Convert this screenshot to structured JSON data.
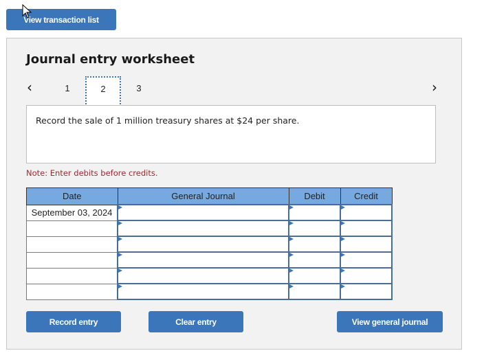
{
  "top_button": {
    "label": "View transaction list"
  },
  "worksheet": {
    "title": "Journal entry worksheet",
    "nav": {
      "prev_icon": "chevron-left-icon",
      "next_icon": "chevron-right-icon"
    },
    "pages": [
      "1",
      "2",
      "3"
    ],
    "active_page": "2",
    "description": "Record the sale of 1 million treasury shares at $24 per share.",
    "note": "Note: Enter debits before credits.",
    "table": {
      "headers": [
        "Date",
        "General Journal",
        "Debit",
        "Credit"
      ],
      "rows": [
        {
          "date": "September 03, 2024",
          "general_journal": "",
          "debit": "",
          "credit": ""
        },
        {
          "date": "",
          "general_journal": "",
          "debit": "",
          "credit": ""
        },
        {
          "date": "",
          "general_journal": "",
          "debit": "",
          "credit": ""
        },
        {
          "date": "",
          "general_journal": "",
          "debit": "",
          "credit": ""
        },
        {
          "date": "",
          "general_journal": "",
          "debit": "",
          "credit": ""
        },
        {
          "date": "",
          "general_journal": "",
          "debit": "",
          "credit": ""
        }
      ]
    },
    "buttons": {
      "record": "Record entry",
      "clear": "Clear entry",
      "view_journal": "View general journal"
    }
  },
  "colors": {
    "button_blue": "#3b75ba",
    "header_blue": "#76a9e0",
    "note_red": "#a3282d"
  }
}
